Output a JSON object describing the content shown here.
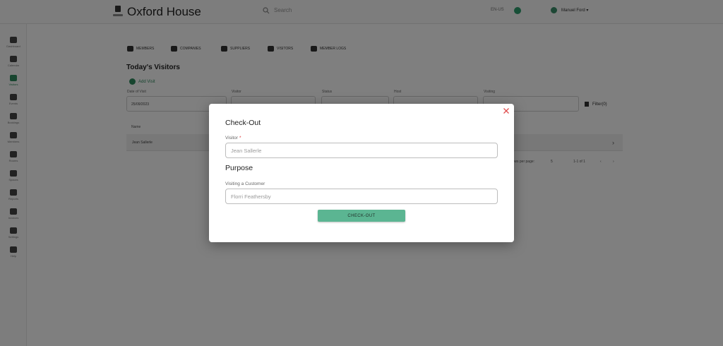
{
  "app": {
    "title": "Oxford House",
    "search_placeholder": "Search",
    "language": "EN-US",
    "user_name": "Manuel Ford"
  },
  "sidebar": {
    "items": [
      {
        "label": "Dashboard",
        "icon": "home-icon"
      },
      {
        "label": "Calendar",
        "icon": "calendar-icon"
      },
      {
        "label": "Visitors",
        "icon": "visitors-icon",
        "active": true
      },
      {
        "label": "Events",
        "icon": "events-icon"
      },
      {
        "label": "Bookings",
        "icon": "bookings-icon"
      },
      {
        "label": "Members",
        "icon": "members-icon"
      },
      {
        "label": "Rooms",
        "icon": "rooms-icon"
      },
      {
        "label": "Spaces",
        "icon": "spaces-icon"
      },
      {
        "label": "Reports",
        "icon": "reports-icon"
      },
      {
        "label": "Invoices",
        "icon": "invoices-icon"
      },
      {
        "label": "Settings",
        "icon": "settings-icon"
      },
      {
        "label": "Help",
        "icon": "help-icon"
      }
    ]
  },
  "page": {
    "tabs": [
      {
        "label": "MEMBERS"
      },
      {
        "label": "COMPANIES"
      },
      {
        "label": "SUPPLIERS"
      },
      {
        "label": "VISITORS"
      },
      {
        "label": "MEMBER LOGS"
      }
    ],
    "section_title": "Today's Visitors",
    "add_visit_label": "Add Visit",
    "filters": [
      {
        "label": "Date of Visit",
        "value": "25/09/2023"
      },
      {
        "label": "Visitor",
        "value": ""
      },
      {
        "label": "Status",
        "value": ""
      },
      {
        "label": "Host",
        "value": ""
      },
      {
        "label": "Visiting",
        "value": ""
      }
    ],
    "filter_button": "Filter(0)",
    "table_header": "Name",
    "table_row": "Jean Sallerle",
    "pagination": {
      "rows_label": "Rows per page:",
      "rows_value": "5",
      "range": "1-1 of 1"
    }
  },
  "modal": {
    "title": "Check-Out",
    "visitor_label": "Visitor",
    "visitor_required_mark": "*",
    "visitor_value": "Jean Sallerle",
    "purpose_heading": "Purpose",
    "purpose_label": "Visiting a Customer",
    "purpose_value": "Florri Feathersby",
    "submit_label": "CHECK-OUT",
    "close_icon": "close-icon"
  },
  "colors": {
    "accent": "#5bb592",
    "close": "#e05050",
    "required": "#d33333"
  }
}
